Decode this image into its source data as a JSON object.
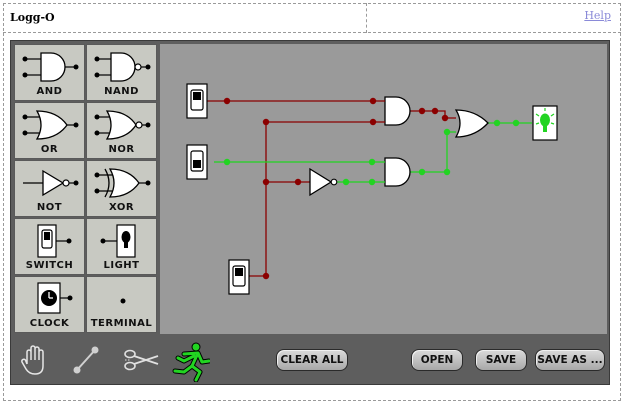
{
  "header": {
    "app_title": "Logg-O",
    "help_label": "Help"
  },
  "palette": {
    "items": [
      {
        "label": "AND"
      },
      {
        "label": "NAND"
      },
      {
        "label": "OR"
      },
      {
        "label": "NOR"
      },
      {
        "label": "NOT"
      },
      {
        "label": "XOR"
      },
      {
        "label": "SWITCH"
      },
      {
        "label": "LIGHT"
      },
      {
        "label": "CLOCK"
      },
      {
        "label": "TERMINAL"
      }
    ]
  },
  "toolbar": {
    "clear_all_label": "CLEAR ALL",
    "open_label": "OPEN",
    "save_label": "SAVE",
    "save_as_label": "SAVE AS ..."
  },
  "colors": {
    "wire_off": "#8b0000",
    "wire_on": "#22d422",
    "canvas": "#9a9a9a",
    "applet_bg": "#5e5e5e",
    "palette_cell": "#c8c9c2",
    "run_icon": "#22d422"
  },
  "icons": [
    "hand-icon",
    "wire-tool-icon",
    "scissors-icon",
    "run-icon",
    "bulb-icon"
  ]
}
